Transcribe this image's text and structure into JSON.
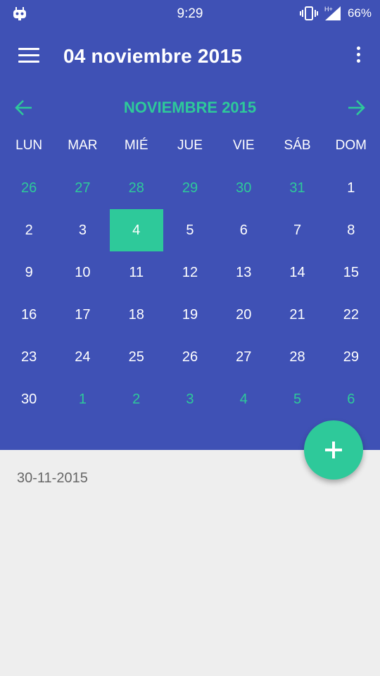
{
  "status_bar": {
    "time": "9:29",
    "battery": "66%",
    "icons": [
      "robot-icon",
      "vibrate-icon",
      "hplus-signal-icon",
      "battery-icon"
    ]
  },
  "app_bar": {
    "title": "04 noviembre 2015",
    "menu_icon": "hamburger-icon",
    "more_icon": "more-vert-icon"
  },
  "calendar": {
    "month_label": "NOVIEMBRE 2015",
    "weekdays": [
      "LUN",
      "MAR",
      "MIÉ",
      "JUE",
      "VIE",
      "SÁB",
      "DOM"
    ],
    "weeks": [
      [
        {
          "d": "26",
          "other": true
        },
        {
          "d": "27",
          "other": true
        },
        {
          "d": "28",
          "other": true
        },
        {
          "d": "29",
          "other": true
        },
        {
          "d": "30",
          "other": true
        },
        {
          "d": "31",
          "other": true
        },
        {
          "d": "1",
          "other": false
        }
      ],
      [
        {
          "d": "2",
          "other": false
        },
        {
          "d": "3",
          "other": false
        },
        {
          "d": "4",
          "other": false,
          "selected": true
        },
        {
          "d": "5",
          "other": false
        },
        {
          "d": "6",
          "other": false
        },
        {
          "d": "7",
          "other": false
        },
        {
          "d": "8",
          "other": false
        }
      ],
      [
        {
          "d": "9",
          "other": false
        },
        {
          "d": "10",
          "other": false
        },
        {
          "d": "11",
          "other": false
        },
        {
          "d": "12",
          "other": false
        },
        {
          "d": "13",
          "other": false
        },
        {
          "d": "14",
          "other": false
        },
        {
          "d": "15",
          "other": false
        }
      ],
      [
        {
          "d": "16",
          "other": false
        },
        {
          "d": "17",
          "other": false
        },
        {
          "d": "18",
          "other": false
        },
        {
          "d": "19",
          "other": false
        },
        {
          "d": "20",
          "other": false
        },
        {
          "d": "21",
          "other": false
        },
        {
          "d": "22",
          "other": false
        }
      ],
      [
        {
          "d": "23",
          "other": false
        },
        {
          "d": "24",
          "other": false
        },
        {
          "d": "25",
          "other": false
        },
        {
          "d": "26",
          "other": false
        },
        {
          "d": "27",
          "other": false
        },
        {
          "d": "28",
          "other": false
        },
        {
          "d": "29",
          "other": false
        }
      ],
      [
        {
          "d": "30",
          "other": false
        },
        {
          "d": "1",
          "other": true
        },
        {
          "d": "2",
          "other": true
        },
        {
          "d": "3",
          "other": true
        },
        {
          "d": "4",
          "other": true
        },
        {
          "d": "5",
          "other": true
        },
        {
          "d": "6",
          "other": true
        }
      ]
    ]
  },
  "event_list": {
    "items": [
      {
        "date": "30-11-2015"
      }
    ]
  },
  "colors": {
    "primary": "#3f51b5",
    "accent": "#2ec99a",
    "background": "#eeeeee"
  }
}
